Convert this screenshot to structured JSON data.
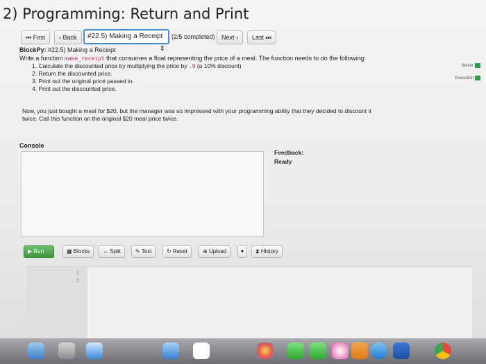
{
  "page": {
    "title": "2) Programming: Return and Print"
  },
  "nav": {
    "first_label": "First",
    "back_label": "Back",
    "problem_select": "#22.5) Making a Receipt",
    "progress": "(2/5 completed)",
    "next_label": "Next",
    "last_label": "Last"
  },
  "problem": {
    "heading": "BlockPy:",
    "subheading": "#22.5) Making a Receipt",
    "intro_before": "Write a function ",
    "function_name": "make_receipt",
    "intro_after": " that consumes a float representing the price of a meal. The function needs to do the following:",
    "steps": [
      {
        "before": "1. Calculate the discounted price by multiplying the price by ",
        "code": ".9",
        "after": " (a 10% discount)"
      },
      {
        "before": "2. Return the discounted price.",
        "code": "",
        "after": ""
      },
      {
        "before": "3. Print out the original price passed in.",
        "code": "",
        "after": ""
      },
      {
        "before": "4. Print out the discounted price.",
        "code": "",
        "after": ""
      }
    ],
    "story": "Now, you just bought a meal for $20, but the manager was so impressed with your programming ability that they decided to discount it twice. Call this function on the original $20 meal price twice."
  },
  "right_panel": {
    "server_label": "Server",
    "execution_label": "Execution"
  },
  "console": {
    "label": "Console"
  },
  "feedback": {
    "label": "Feedback:",
    "status": "Ready"
  },
  "toolbar": {
    "run_label": "Run",
    "blocks_label": "Blocks",
    "split_label": "Split",
    "text_label": "Text",
    "reset_label": "Reset",
    "upload_label": "Upload",
    "history_label": "History"
  },
  "editor": {
    "line_numbers": [
      "1",
      "2"
    ]
  },
  "dock": {
    "icons": [
      "finder-icon",
      "launchpad-icon",
      "safari-icon",
      "mail-icon",
      "calendar-icon",
      "photos-icon",
      "messages-icon",
      "facetime-icon",
      "itunes-icon",
      "ibooks-icon",
      "appstore-icon",
      "word-icon",
      "chrome-icon"
    ]
  },
  "colors": {
    "accent_blue": "#4a8fd6",
    "run_green": "#3f9a3f",
    "code_pink": "#b0306a"
  }
}
